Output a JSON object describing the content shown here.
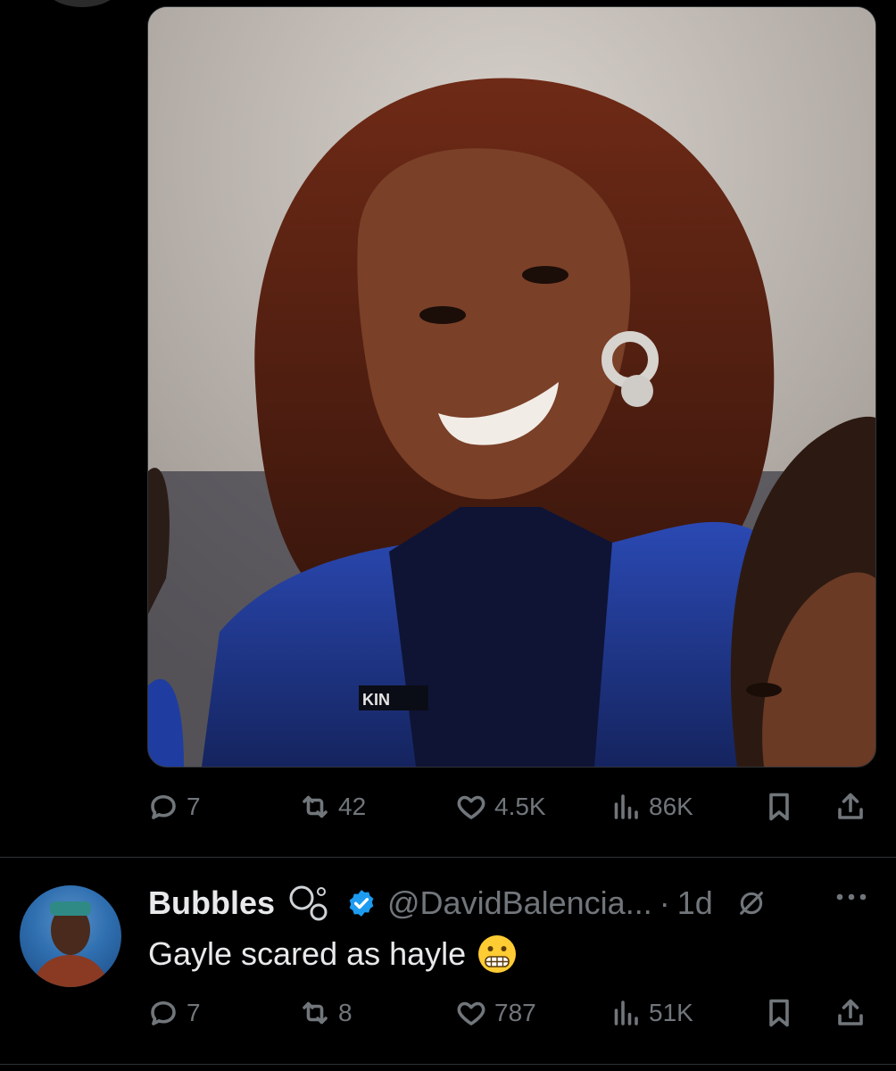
{
  "tweet": {
    "stats": {
      "replies": "7",
      "reposts": "42",
      "likes": "4.5K",
      "views": "86K"
    }
  },
  "reply": {
    "display_name": "Bubbles",
    "handle": "@DavidBalencia...",
    "separator": "·",
    "time": "1d",
    "text": "Gayle scared as hayle",
    "stats": {
      "replies": "7",
      "reposts": "8",
      "likes": "787",
      "views": "51K"
    }
  },
  "colors": {
    "background": "#000000",
    "text_primary": "#e7e9ea",
    "text_secondary": "#71767b",
    "verified_blue": "#1d9bf0",
    "divider": "#2f3336"
  },
  "icons": [
    "reply-icon",
    "repost-icon",
    "like-icon",
    "views-icon",
    "bookmark-icon",
    "share-icon",
    "verified-badge-icon",
    "grok-icon",
    "more-icon"
  ]
}
